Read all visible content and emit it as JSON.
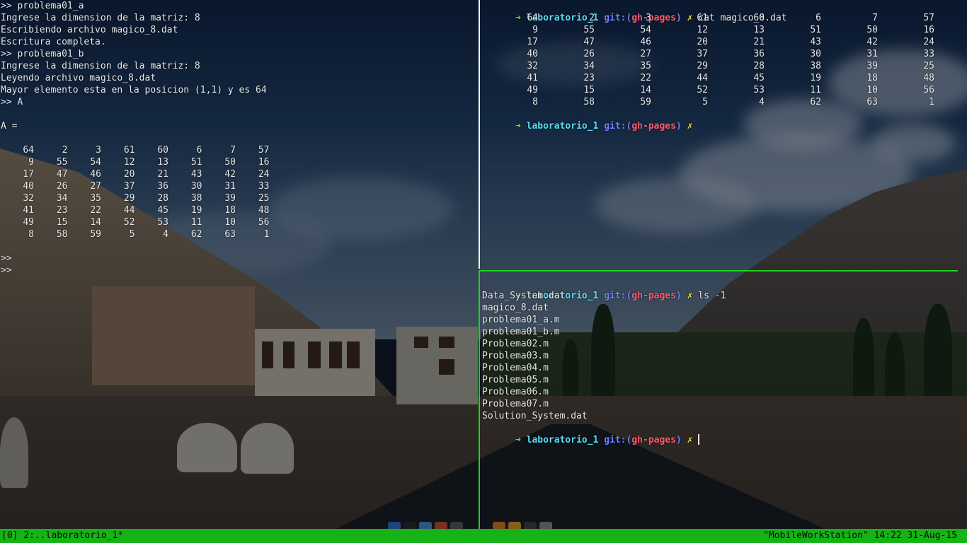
{
  "left_pane": {
    "lines_top": [
      ">> problema01_a",
      "Ingrese la dimension de la matriz: 8",
      "Escribiendo archivo magico_8.dat",
      "Escritura completa.",
      ">> problema01_b",
      "Ingrese la dimension de la matriz: 8",
      "Leyendo archivo magico_8.dat",
      "Mayor elemento esta en la posicion (1,1) y es 64",
      ">> A",
      "",
      "A =",
      ""
    ],
    "matrix": [
      [
        "64",
        "2",
        "3",
        "61",
        "60",
        "6",
        "7",
        "57"
      ],
      [
        "9",
        "55",
        "54",
        "12",
        "13",
        "51",
        "50",
        "16"
      ],
      [
        "17",
        "47",
        "46",
        "20",
        "21",
        "43",
        "42",
        "24"
      ],
      [
        "40",
        "26",
        "27",
        "37",
        "36",
        "30",
        "31",
        "33"
      ],
      [
        "32",
        "34",
        "35",
        "29",
        "28",
        "38",
        "39",
        "25"
      ],
      [
        "41",
        "23",
        "22",
        "44",
        "45",
        "19",
        "18",
        "48"
      ],
      [
        "49",
        "15",
        "14",
        "52",
        "53",
        "11",
        "10",
        "56"
      ],
      [
        "8",
        "58",
        "59",
        "5",
        "4",
        "62",
        "63",
        "1"
      ]
    ],
    "lines_bottom": [
      "",
      ">>",
      ">>"
    ]
  },
  "top_right_pane": {
    "prompt": {
      "arrow": "➜",
      "dir": "laboratorio_1",
      "git": "git:",
      "branch_open": "(",
      "branch": "gh-pages",
      "branch_close": ")",
      "dirty": "✗"
    },
    "command": "cat magico_8.dat",
    "matrix": [
      [
        "64",
        "2",
        "3",
        "61",
        "60",
        "6",
        "7",
        "57"
      ],
      [
        "9",
        "55",
        "54",
        "12",
        "13",
        "51",
        "50",
        "16"
      ],
      [
        "17",
        "47",
        "46",
        "20",
        "21",
        "43",
        "42",
        "24"
      ],
      [
        "40",
        "26",
        "27",
        "37",
        "36",
        "30",
        "31",
        "33"
      ],
      [
        "32",
        "34",
        "35",
        "29",
        "28",
        "38",
        "39",
        "25"
      ],
      [
        "41",
        "23",
        "22",
        "44",
        "45",
        "19",
        "18",
        "48"
      ],
      [
        "49",
        "15",
        "14",
        "52",
        "53",
        "11",
        "10",
        "56"
      ],
      [
        "8",
        "58",
        "59",
        "5",
        "4",
        "62",
        "63",
        "1"
      ]
    ]
  },
  "bottom_right_pane": {
    "command": "ls -1",
    "files": [
      "Data_System.dat",
      "magico_8.dat",
      "problema01_a.m",
      "problema01_b.m",
      "Problema02.m",
      "Problema03.m",
      "Problema04.m",
      "Problema05.m",
      "Problema06.m",
      "Problema07.m",
      "Solution_System.dat"
    ]
  },
  "status_bar": {
    "left": "[0] 2:..laboratorio_1*",
    "right": "\"MobileWorkStation\" 14:22 31-Aug-15"
  },
  "colors": {
    "status_bg": "#16b316",
    "pane_border_active": "#1fd11f",
    "prompt_arrow": "#3cf03c",
    "prompt_dir": "#59dcf0",
    "prompt_git": "#6a82ff",
    "prompt_branch": "#ff5a6e",
    "prompt_dirty": "#f5e64a"
  }
}
